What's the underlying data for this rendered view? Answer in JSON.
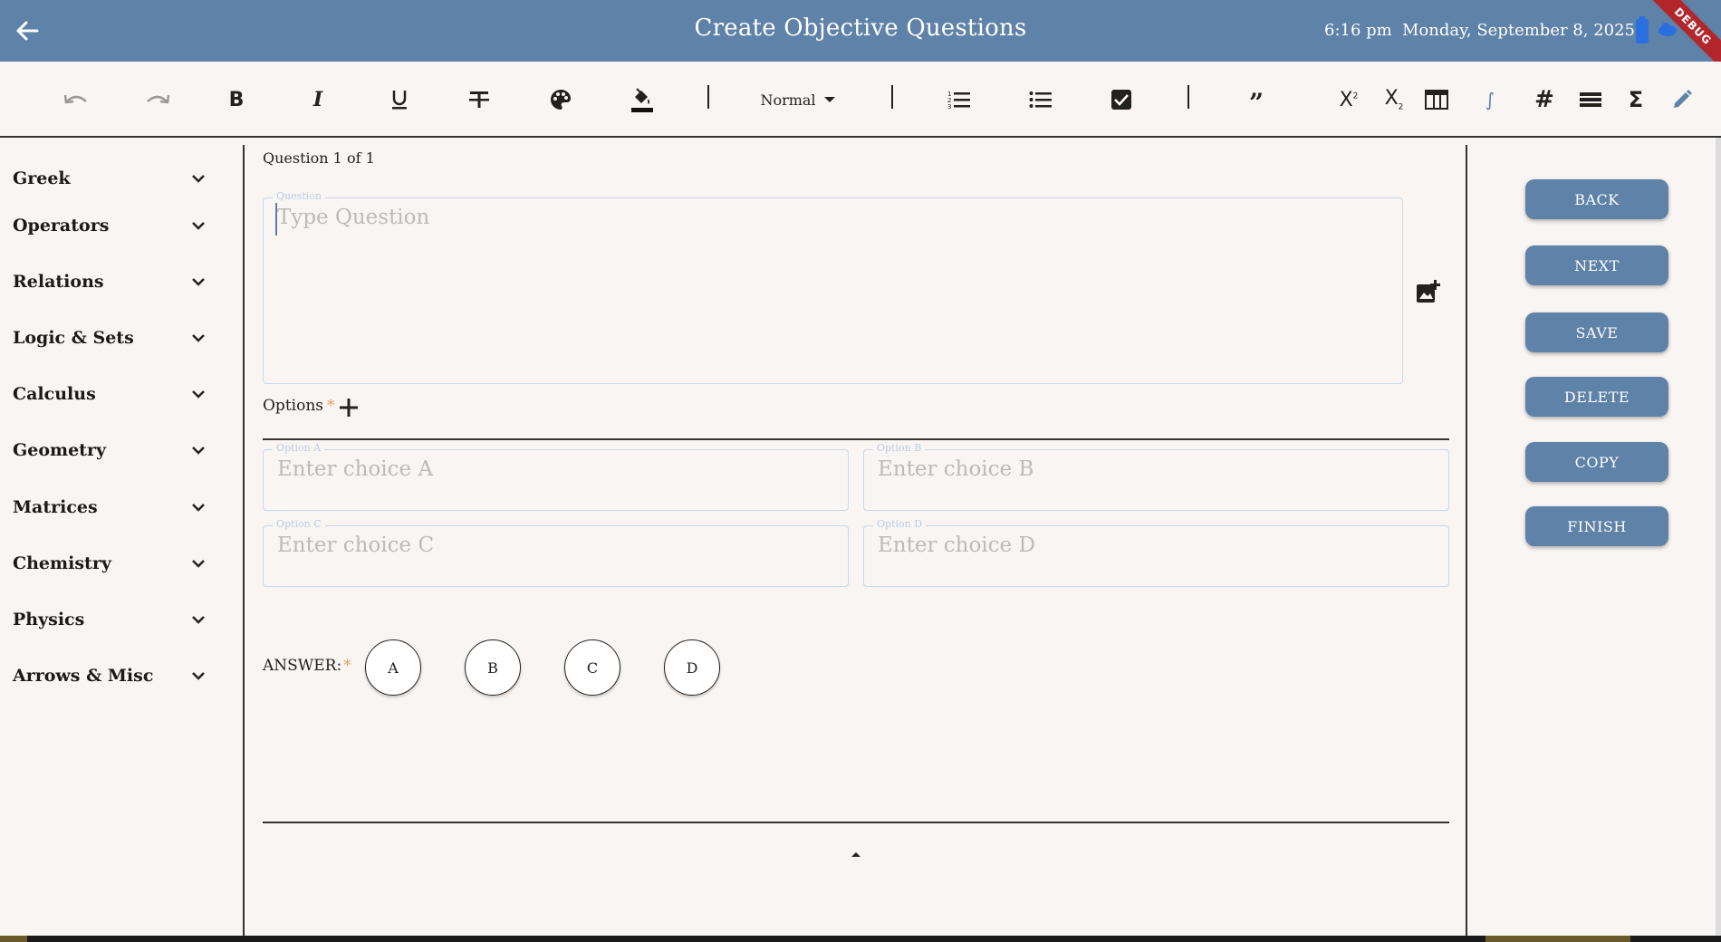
{
  "appbar": {
    "title": "Create Objective Questions",
    "time": "6:16 pm",
    "date": "Monday, September 8, 2025",
    "debug_label": "DEBUG"
  },
  "toolbar": {
    "style_dropdown": "Normal",
    "buttons": [
      "undo-icon",
      "redo-icon",
      "bold-icon",
      "italic-icon",
      "underline-icon",
      "strikethrough-icon",
      "palette-icon",
      "fill-color-icon",
      "numbered-list-icon",
      "bullet-list-icon",
      "checkbox-icon",
      "quote-icon",
      "superscript-icon",
      "subscript-icon",
      "table-icon",
      "integral-icon",
      "hash-icon",
      "horizontal-rule-icon",
      "sigma-icon",
      "pencil-icon"
    ]
  },
  "sidebar": {
    "items": [
      {
        "label": "Greek"
      },
      {
        "label": "Operators"
      },
      {
        "label": "Relations"
      },
      {
        "label": "Logic & Sets"
      },
      {
        "label": "Calculus"
      },
      {
        "label": "Geometry"
      },
      {
        "label": "Matrices"
      },
      {
        "label": "Chemistry"
      },
      {
        "label": "Physics"
      },
      {
        "label": "Arrows & Misc"
      }
    ]
  },
  "main": {
    "counter": "Question 1 of 1",
    "question": {
      "label": "Question",
      "placeholder": "Type Question"
    },
    "options_label": "Options",
    "required_mark": "*",
    "options": [
      {
        "label": "Option A",
        "placeholder": "Enter choice A"
      },
      {
        "label": "Option B",
        "placeholder": "Enter choice B"
      },
      {
        "label": "Option C",
        "placeholder": "Enter choice C"
      },
      {
        "label": "Option D",
        "placeholder": "Enter choice D"
      }
    ],
    "answer_label": "ANSWER:",
    "answers": [
      "A",
      "B",
      "C",
      "D"
    ]
  },
  "actions": [
    "BACK",
    "NEXT",
    "SAVE",
    "DELETE",
    "COPY",
    "FINISH"
  ],
  "colors": {
    "primary": "#5f82a8",
    "background": "#f8f5f2",
    "field_border": "#c7d8ee",
    "required": "#e8a060"
  }
}
